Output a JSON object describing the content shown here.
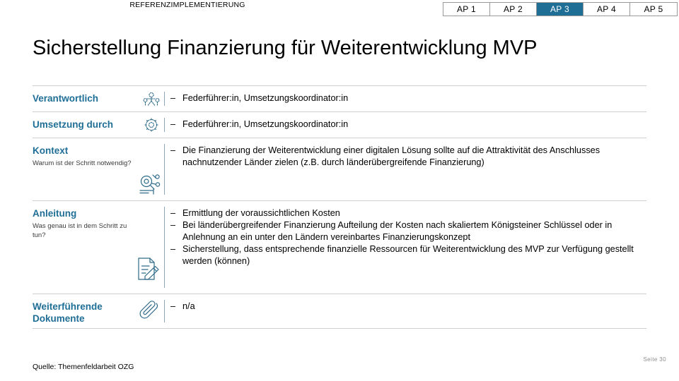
{
  "eyebrow": "REFERENZIMPLEMENTIERUNG",
  "title": "Sicherstellung Finanzierung für Weiterentwicklung MVP",
  "accent_color": "#1f6e96",
  "tabs": [
    {
      "label": "AP 1",
      "active": false
    },
    {
      "label": "AP 2",
      "active": false
    },
    {
      "label": "AP 3",
      "active": true
    },
    {
      "label": "AP 4",
      "active": false
    },
    {
      "label": "AP 5",
      "active": false
    }
  ],
  "rows": [
    {
      "heading": "Verantwortlich",
      "subtitle": "",
      "icon": "people-group-icon",
      "bullets": [
        "Federführer:in, Umsetzungskoordinator:in"
      ]
    },
    {
      "heading": "Umsetzung durch",
      "subtitle": "",
      "icon": "gear-network-icon",
      "bullets": [
        "Federführer:in, Umsetzungskoordinator:in"
      ]
    },
    {
      "heading": "Kontext",
      "subtitle": "Warum ist der Schritt notwendig?",
      "icon": "magnifier-analysis-icon",
      "bullets": [
        "Die Finanzierung der Weiterentwicklung einer digitalen Lösung sollte auf die Attraktivität des Anschlusses nachnutzender Länder zielen (z.B. durch länderübergreifende Finanzierung)"
      ]
    },
    {
      "heading": "Anleitung",
      "subtitle": "Was genau ist in dem Schritt zu tun?",
      "icon": "document-pencil-icon",
      "bullets": [
        "Ermittlung der voraussichtlichen Kosten",
        "Bei länderübergreifender Finanzierung Aufteilung der Kosten nach skaliertem Königsteiner Schlüssel oder in Anlehnung an ein unter den Ländern vereinbartes Finanzierungskonzept",
        "Sicherstellung, dass entsprechende finanzielle Ressourcen für Weiterentwicklung des MVP zur Verfügung gestellt werden (können)"
      ]
    },
    {
      "heading": "Weiterführende Dokumente",
      "subtitle": "",
      "icon": "paperclip-icon",
      "bullets": [
        "n/a"
      ]
    }
  ],
  "footer": {
    "source": "Quelle: Themenfeldarbeit OZG",
    "page_number": "Seite 30"
  }
}
